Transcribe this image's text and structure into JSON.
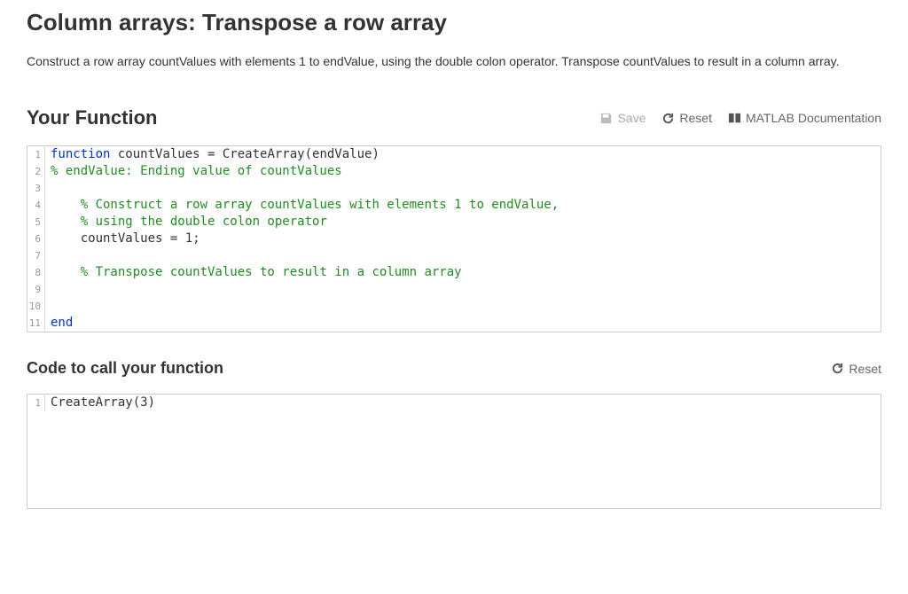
{
  "title": "Column arrays: Transpose a row array",
  "instructions": "Construct a row array countValues with elements 1 to endValue, using the double colon operator. Transpose countValues to result in a column array.",
  "function_section": {
    "title": "Your Function",
    "toolbar": {
      "save_label": "Save",
      "reset_label": "Reset",
      "docs_label": "MATLAB Documentation"
    },
    "code": {
      "lines": [
        {
          "n": "1",
          "tokens": [
            {
              "t": "function",
              "c": "kw"
            },
            {
              "t": " countValues = CreateArray(endValue)",
              "c": ""
            }
          ]
        },
        {
          "n": "2",
          "tokens": [
            {
              "t": "% endValue: Ending value of countValues",
              "c": "cm"
            }
          ]
        },
        {
          "n": "3",
          "tokens": []
        },
        {
          "n": "4",
          "tokens": [
            {
              "t": "    ",
              "c": ""
            },
            {
              "t": "% Construct a row array countValues with elements 1 to endValue,",
              "c": "cm"
            }
          ]
        },
        {
          "n": "5",
          "tokens": [
            {
              "t": "    ",
              "c": ""
            },
            {
              "t": "% using the double colon operator",
              "c": "cm"
            }
          ]
        },
        {
          "n": "6",
          "tokens": [
            {
              "t": "    countValues = 1;",
              "c": ""
            }
          ]
        },
        {
          "n": "7",
          "tokens": []
        },
        {
          "n": "8",
          "tokens": [
            {
              "t": "    ",
              "c": ""
            },
            {
              "t": "% Transpose countValues to result in a column array",
              "c": "cm"
            }
          ]
        },
        {
          "n": "9",
          "tokens": []
        },
        {
          "n": "10",
          "tokens": []
        },
        {
          "n": "11",
          "tokens": [
            {
              "t": "end",
              "c": "kw"
            }
          ]
        }
      ]
    }
  },
  "call_section": {
    "title": "Code to call your function",
    "reset_label": "Reset",
    "code": {
      "lines": [
        {
          "n": "1",
          "tokens": [
            {
              "t": "CreateArray(3)",
              "c": ""
            }
          ]
        }
      ]
    }
  }
}
